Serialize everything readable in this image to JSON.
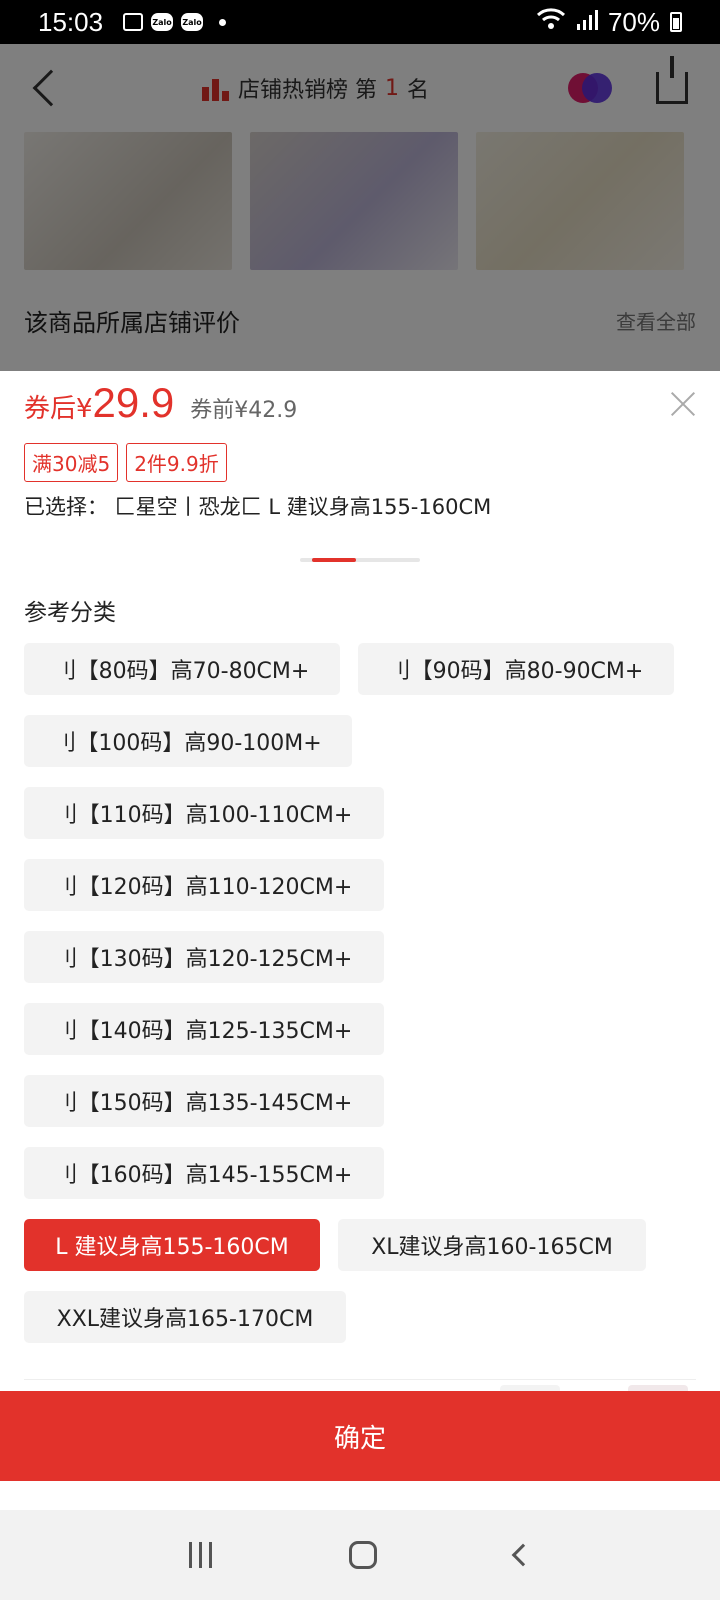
{
  "status_bar": {
    "time": "15:03",
    "notif_icons": [
      "image-icon",
      "zalo-icon",
      "zalo-icon"
    ],
    "battery": "70%"
  },
  "background_page": {
    "rank_text": "店铺热销榜 第",
    "rank_number": "1",
    "rank_suffix": "名",
    "store_review_title": "该商品所属店铺评价",
    "view_all": "查看全部"
  },
  "sheet": {
    "price_label": "券后¥",
    "price_value": "29.9",
    "original_price": "券前¥42.9",
    "promos": [
      "满30减5",
      "2件9.9折"
    ],
    "selected_text": "已选择：  匚星空丨恐龙匚 L 建议身高155-160CM",
    "section_title": "参考分类",
    "options": [
      "刂【80码】高70-80CM+",
      "刂【90码】高80-90CM+",
      "刂【100码】高90-100M+",
      "刂【110码】高100-110CM+",
      "刂【120码】高110-120CM+",
      "刂【130码】高120-125CM+",
      "刂【140码】高125-135CM+",
      "刂【150码】高135-145CM+",
      "刂【160码】高145-155CM+",
      "L 建议身高155-160CM",
      "XL建议身高160-165CM",
      "XXL建议身高165-170CM"
    ],
    "selected_option": "L 建议身高155-160CM",
    "confirm_label": "确定"
  },
  "colors": {
    "accent": "#e2322b",
    "option_bg": "#f3f3f3"
  }
}
